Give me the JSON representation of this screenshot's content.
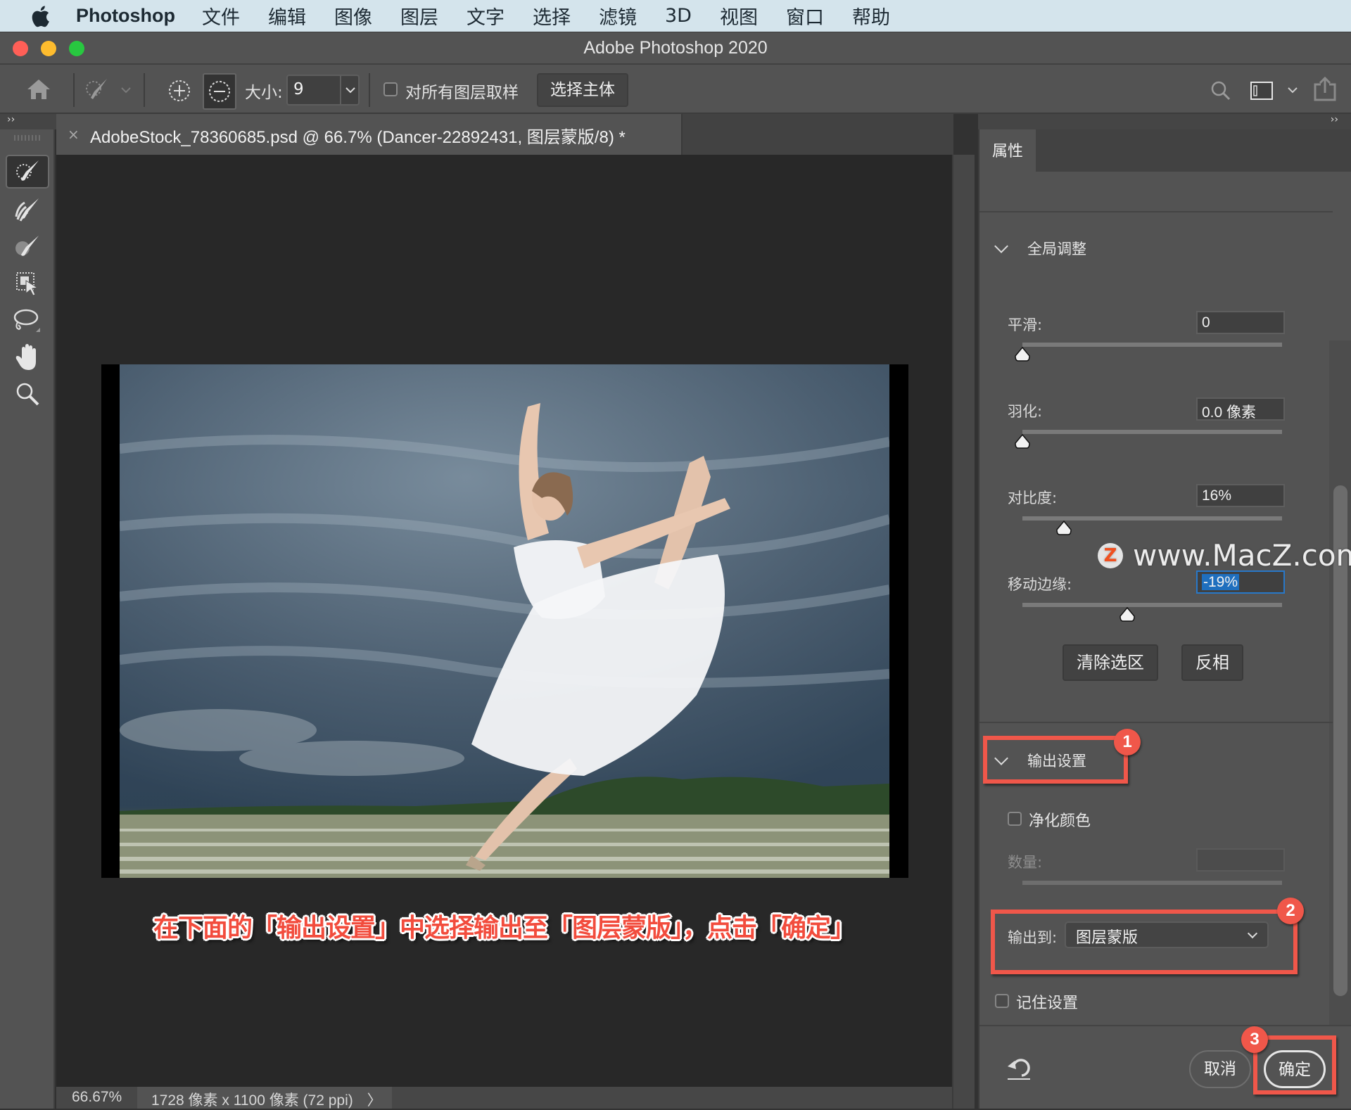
{
  "menubar": {
    "app_name": "Photoshop",
    "items": [
      "文件",
      "编辑",
      "图像",
      "图层",
      "文字",
      "选择",
      "滤镜",
      "3D",
      "视图",
      "窗口",
      "帮助"
    ]
  },
  "window": {
    "title": "Adobe Photoshop 2020",
    "traffic_lights": {
      "close": "#ff5f57",
      "minimize": "#febc2e",
      "zoom": "#28c840"
    }
  },
  "options_bar": {
    "size_label": "大小:",
    "size_value": "9",
    "sample_all_layers_label": "对所有图层取样",
    "sample_all_layers_checked": false,
    "select_subject_label": "选择主体"
  },
  "document": {
    "tab_title": "AdobeStock_78360685.psd @ 66.7% (Dancer-22892431, 图层蒙版/8) *",
    "close_glyph": "×",
    "zoom": "66.67%",
    "doc_info": "1728 像素 x 1100 像素 (72 ppi)",
    "status_arrow": "〉"
  },
  "tools": [
    {
      "name": "quick-selection-brush-icon",
      "active": true
    },
    {
      "name": "refine-edge-brush-icon",
      "active": false
    },
    {
      "name": "brush-icon",
      "active": false
    },
    {
      "name": "object-selection-icon",
      "active": false
    },
    {
      "name": "lasso-icon",
      "active": false
    },
    {
      "name": "hand-icon",
      "active": false
    },
    {
      "name": "zoom-icon",
      "active": false
    }
  ],
  "collapse_glyph": "››",
  "annotation_text": "在下面的「输出设置」中选择输出至「图层蒙版」，点击「确定」",
  "panel": {
    "tab_label": "属性",
    "global_section": {
      "title": "全局调整",
      "smooth": {
        "label": "平滑:",
        "value": "0",
        "slider_fraction": 0.0
      },
      "feather": {
        "label": "羽化:",
        "value": "0.0 像素",
        "slider_fraction": 0.0
      },
      "contrast": {
        "label": "对比度:",
        "value": "16%",
        "slider_fraction": 0.16
      },
      "shift_edge": {
        "label": "移动边缘:",
        "value": "-19%",
        "slider_fraction": 0.405
      },
      "clear_selection_label": "清除选区",
      "invert_label": "反相"
    },
    "output_section": {
      "title": "输出设置",
      "decontaminate_label": "净化颜色",
      "decontaminate_checked": false,
      "amount_label": "数量:",
      "amount_value": "",
      "output_to_label": "输出到:",
      "output_to_value": "图层蒙版",
      "remember_label": "记住设置",
      "remember_checked": false
    },
    "cancel_label": "取消",
    "ok_label": "确定"
  },
  "callouts": [
    {
      "number": "1",
      "color": "#f0574a"
    },
    {
      "number": "2",
      "color": "#f0574a"
    },
    {
      "number": "3",
      "color": "#f0574a"
    }
  ],
  "watermark": {
    "logo": "Z",
    "text": "www.MacZ.com"
  }
}
